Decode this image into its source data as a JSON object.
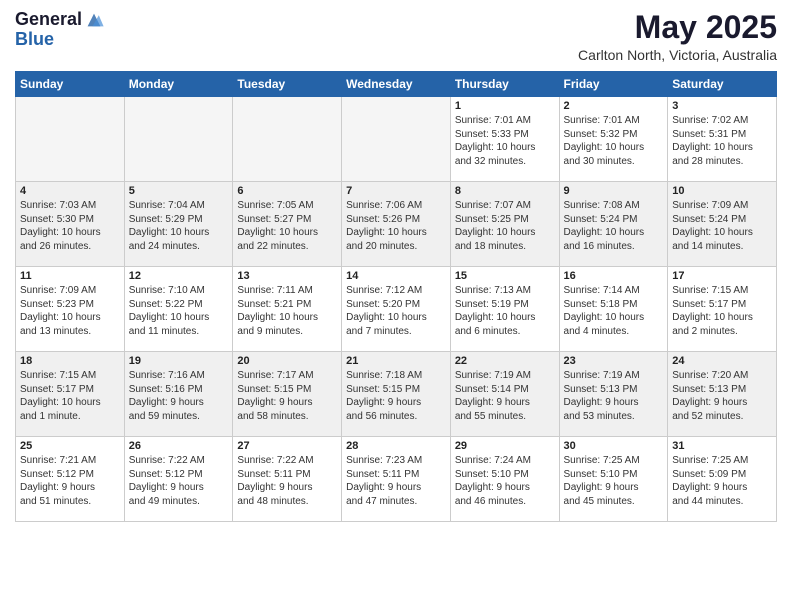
{
  "header": {
    "logo_general": "General",
    "logo_blue": "Blue",
    "month_title": "May 2025",
    "location": "Carlton North, Victoria, Australia"
  },
  "weekdays": [
    "Sunday",
    "Monday",
    "Tuesday",
    "Wednesday",
    "Thursday",
    "Friday",
    "Saturday"
  ],
  "weeks": [
    [
      {
        "day": "",
        "empty": true
      },
      {
        "day": "",
        "empty": true
      },
      {
        "day": "",
        "empty": true
      },
      {
        "day": "",
        "empty": true
      },
      {
        "day": "1",
        "lines": [
          "Sunrise: 7:01 AM",
          "Sunset: 5:33 PM",
          "Daylight: 10 hours",
          "and 32 minutes."
        ]
      },
      {
        "day": "2",
        "lines": [
          "Sunrise: 7:01 AM",
          "Sunset: 5:32 PM",
          "Daylight: 10 hours",
          "and 30 minutes."
        ]
      },
      {
        "day": "3",
        "lines": [
          "Sunrise: 7:02 AM",
          "Sunset: 5:31 PM",
          "Daylight: 10 hours",
          "and 28 minutes."
        ]
      }
    ],
    [
      {
        "day": "4",
        "lines": [
          "Sunrise: 7:03 AM",
          "Sunset: 5:30 PM",
          "Daylight: 10 hours",
          "and 26 minutes."
        ]
      },
      {
        "day": "5",
        "lines": [
          "Sunrise: 7:04 AM",
          "Sunset: 5:29 PM",
          "Daylight: 10 hours",
          "and 24 minutes."
        ]
      },
      {
        "day": "6",
        "lines": [
          "Sunrise: 7:05 AM",
          "Sunset: 5:27 PM",
          "Daylight: 10 hours",
          "and 22 minutes."
        ]
      },
      {
        "day": "7",
        "lines": [
          "Sunrise: 7:06 AM",
          "Sunset: 5:26 PM",
          "Daylight: 10 hours",
          "and 20 minutes."
        ]
      },
      {
        "day": "8",
        "lines": [
          "Sunrise: 7:07 AM",
          "Sunset: 5:25 PM",
          "Daylight: 10 hours",
          "and 18 minutes."
        ]
      },
      {
        "day": "9",
        "lines": [
          "Sunrise: 7:08 AM",
          "Sunset: 5:24 PM",
          "Daylight: 10 hours",
          "and 16 minutes."
        ]
      },
      {
        "day": "10",
        "lines": [
          "Sunrise: 7:09 AM",
          "Sunset: 5:24 PM",
          "Daylight: 10 hours",
          "and 14 minutes."
        ]
      }
    ],
    [
      {
        "day": "11",
        "lines": [
          "Sunrise: 7:09 AM",
          "Sunset: 5:23 PM",
          "Daylight: 10 hours",
          "and 13 minutes."
        ]
      },
      {
        "day": "12",
        "lines": [
          "Sunrise: 7:10 AM",
          "Sunset: 5:22 PM",
          "Daylight: 10 hours",
          "and 11 minutes."
        ]
      },
      {
        "day": "13",
        "lines": [
          "Sunrise: 7:11 AM",
          "Sunset: 5:21 PM",
          "Daylight: 10 hours",
          "and 9 minutes."
        ]
      },
      {
        "day": "14",
        "lines": [
          "Sunrise: 7:12 AM",
          "Sunset: 5:20 PM",
          "Daylight: 10 hours",
          "and 7 minutes."
        ]
      },
      {
        "day": "15",
        "lines": [
          "Sunrise: 7:13 AM",
          "Sunset: 5:19 PM",
          "Daylight: 10 hours",
          "and 6 minutes."
        ]
      },
      {
        "day": "16",
        "lines": [
          "Sunrise: 7:14 AM",
          "Sunset: 5:18 PM",
          "Daylight: 10 hours",
          "and 4 minutes."
        ]
      },
      {
        "day": "17",
        "lines": [
          "Sunrise: 7:15 AM",
          "Sunset: 5:17 PM",
          "Daylight: 10 hours",
          "and 2 minutes."
        ]
      }
    ],
    [
      {
        "day": "18",
        "lines": [
          "Sunrise: 7:15 AM",
          "Sunset: 5:17 PM",
          "Daylight: 10 hours",
          "and 1 minute."
        ]
      },
      {
        "day": "19",
        "lines": [
          "Sunrise: 7:16 AM",
          "Sunset: 5:16 PM",
          "Daylight: 9 hours",
          "and 59 minutes."
        ]
      },
      {
        "day": "20",
        "lines": [
          "Sunrise: 7:17 AM",
          "Sunset: 5:15 PM",
          "Daylight: 9 hours",
          "and 58 minutes."
        ]
      },
      {
        "day": "21",
        "lines": [
          "Sunrise: 7:18 AM",
          "Sunset: 5:15 PM",
          "Daylight: 9 hours",
          "and 56 minutes."
        ]
      },
      {
        "day": "22",
        "lines": [
          "Sunrise: 7:19 AM",
          "Sunset: 5:14 PM",
          "Daylight: 9 hours",
          "and 55 minutes."
        ]
      },
      {
        "day": "23",
        "lines": [
          "Sunrise: 7:19 AM",
          "Sunset: 5:13 PM",
          "Daylight: 9 hours",
          "and 53 minutes."
        ]
      },
      {
        "day": "24",
        "lines": [
          "Sunrise: 7:20 AM",
          "Sunset: 5:13 PM",
          "Daylight: 9 hours",
          "and 52 minutes."
        ]
      }
    ],
    [
      {
        "day": "25",
        "lines": [
          "Sunrise: 7:21 AM",
          "Sunset: 5:12 PM",
          "Daylight: 9 hours",
          "and 51 minutes."
        ]
      },
      {
        "day": "26",
        "lines": [
          "Sunrise: 7:22 AM",
          "Sunset: 5:12 PM",
          "Daylight: 9 hours",
          "and 49 minutes."
        ]
      },
      {
        "day": "27",
        "lines": [
          "Sunrise: 7:22 AM",
          "Sunset: 5:11 PM",
          "Daylight: 9 hours",
          "and 48 minutes."
        ]
      },
      {
        "day": "28",
        "lines": [
          "Sunrise: 7:23 AM",
          "Sunset: 5:11 PM",
          "Daylight: 9 hours",
          "and 47 minutes."
        ]
      },
      {
        "day": "29",
        "lines": [
          "Sunrise: 7:24 AM",
          "Sunset: 5:10 PM",
          "Daylight: 9 hours",
          "and 46 minutes."
        ]
      },
      {
        "day": "30",
        "lines": [
          "Sunrise: 7:25 AM",
          "Sunset: 5:10 PM",
          "Daylight: 9 hours",
          "and 45 minutes."
        ]
      },
      {
        "day": "31",
        "lines": [
          "Sunrise: 7:25 AM",
          "Sunset: 5:09 PM",
          "Daylight: 9 hours",
          "and 44 minutes."
        ]
      }
    ]
  ]
}
